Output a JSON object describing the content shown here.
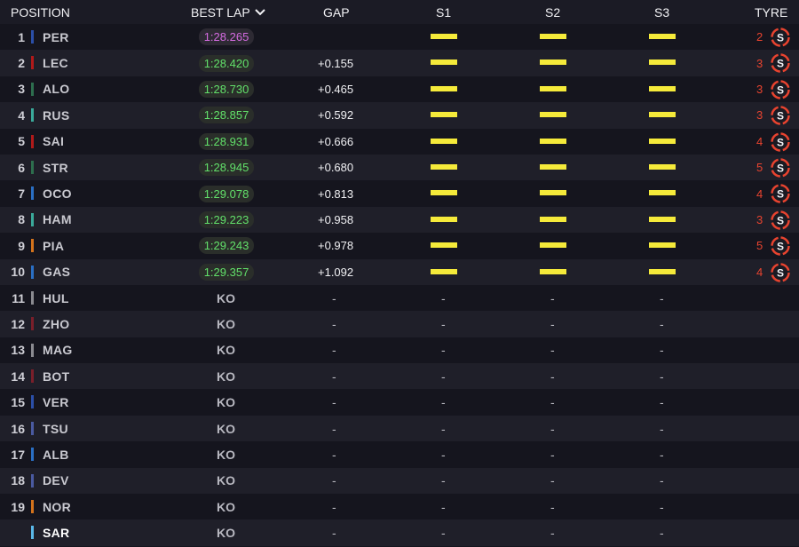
{
  "header": {
    "position": "POSITION",
    "best_lap": "BEST LAP",
    "gap": "GAP",
    "s1": "S1",
    "s2": "S2",
    "s3": "S3",
    "tyre": "TYRE"
  },
  "colors": {
    "sector_yellow": "#f5ea3a",
    "personal_best_green": "#62e06a",
    "fastest_purple": "#d46be0",
    "soft_tyre_red": "#e8432f"
  },
  "rows": [
    {
      "pos": "1",
      "driver": "PER",
      "team_color": "#2b4fa8",
      "best": "1:28.265",
      "best_style": "purple",
      "gap": "",
      "s1": "yellow",
      "s2": "yellow",
      "s3": "yellow",
      "laps": "2",
      "tyre": "S"
    },
    {
      "pos": "2",
      "driver": "LEC",
      "team_color": "#b01a1a",
      "best": "1:28.420",
      "best_style": "green",
      "gap": "+0.155",
      "s1": "yellow",
      "s2": "yellow",
      "s3": "yellow",
      "laps": "3",
      "tyre": "S"
    },
    {
      "pos": "3",
      "driver": "ALO",
      "team_color": "#2d6e4e",
      "best": "1:28.730",
      "best_style": "green",
      "gap": "+0.465",
      "s1": "yellow",
      "s2": "yellow",
      "s3": "yellow",
      "laps": "3",
      "tyre": "S"
    },
    {
      "pos": "4",
      "driver": "RUS",
      "team_color": "#3aa99a",
      "best": "1:28.857",
      "best_style": "green",
      "gap": "+0.592",
      "s1": "yellow",
      "s2": "yellow",
      "s3": "yellow",
      "laps": "3",
      "tyre": "S"
    },
    {
      "pos": "5",
      "driver": "SAI",
      "team_color": "#b01a1a",
      "best": "1:28.931",
      "best_style": "green",
      "gap": "+0.666",
      "s1": "yellow",
      "s2": "yellow",
      "s3": "yellow",
      "laps": "4",
      "tyre": "S"
    },
    {
      "pos": "6",
      "driver": "STR",
      "team_color": "#2d6e4e",
      "best": "1:28.945",
      "best_style": "green",
      "gap": "+0.680",
      "s1": "yellow",
      "s2": "yellow",
      "s3": "yellow",
      "laps": "5",
      "tyre": "S"
    },
    {
      "pos": "7",
      "driver": "OCO",
      "team_color": "#2a6fc4",
      "best": "1:29.078",
      "best_style": "green",
      "gap": "+0.813",
      "s1": "yellow",
      "s2": "yellow",
      "s3": "yellow",
      "laps": "4",
      "tyre": "S"
    },
    {
      "pos": "8",
      "driver": "HAM",
      "team_color": "#3aa99a",
      "best": "1:29.223",
      "best_style": "green",
      "gap": "+0.958",
      "s1": "yellow",
      "s2": "yellow",
      "s3": "yellow",
      "laps": "3",
      "tyre": "S"
    },
    {
      "pos": "9",
      "driver": "PIA",
      "team_color": "#d4731c",
      "best": "1:29.243",
      "best_style": "green",
      "gap": "+0.978",
      "s1": "yellow",
      "s2": "yellow",
      "s3": "yellow",
      "laps": "5",
      "tyre": "S"
    },
    {
      "pos": "10",
      "driver": "GAS",
      "team_color": "#2a6fc4",
      "best": "1:29.357",
      "best_style": "green",
      "gap": "+1.092",
      "s1": "yellow",
      "s2": "yellow",
      "s3": "yellow",
      "laps": "4",
      "tyre": "S"
    },
    {
      "pos": "11",
      "driver": "HUL",
      "team_color": "#8a8a90",
      "best": "KO",
      "gap": "-",
      "s1": "-",
      "s2": "-",
      "s3": "-"
    },
    {
      "pos": "12",
      "driver": "ZHO",
      "team_color": "#7a1f2a",
      "best": "KO",
      "gap": "-",
      "s1": "-",
      "s2": "-",
      "s3": "-"
    },
    {
      "pos": "13",
      "driver": "MAG",
      "team_color": "#8a8a90",
      "best": "KO",
      "gap": "-",
      "s1": "-",
      "s2": "-",
      "s3": "-"
    },
    {
      "pos": "14",
      "driver": "BOT",
      "team_color": "#7a1f2a",
      "best": "KO",
      "gap": "-",
      "s1": "-",
      "s2": "-",
      "s3": "-"
    },
    {
      "pos": "15",
      "driver": "VER",
      "team_color": "#2b4fa8",
      "best": "KO",
      "gap": "-",
      "s1": "-",
      "s2": "-",
      "s3": "-"
    },
    {
      "pos": "16",
      "driver": "TSU",
      "team_color": "#4a5aa0",
      "best": "KO",
      "gap": "-",
      "s1": "-",
      "s2": "-",
      "s3": "-"
    },
    {
      "pos": "17",
      "driver": "ALB",
      "team_color": "#2a6fc4",
      "best": "KO",
      "gap": "-",
      "s1": "-",
      "s2": "-",
      "s3": "-"
    },
    {
      "pos": "18",
      "driver": "DEV",
      "team_color": "#4a5aa0",
      "best": "KO",
      "gap": "-",
      "s1": "-",
      "s2": "-",
      "s3": "-"
    },
    {
      "pos": "19",
      "driver": "NOR",
      "team_color": "#d4731c",
      "best": "KO",
      "gap": "-",
      "s1": "-",
      "s2": "-",
      "s3": "-"
    },
    {
      "pos": "",
      "driver": "SAR",
      "team_color": "#5ab8e8",
      "best": "KO",
      "gap": "-",
      "s1": "-",
      "s2": "-",
      "s3": "-",
      "selected": true
    }
  ]
}
